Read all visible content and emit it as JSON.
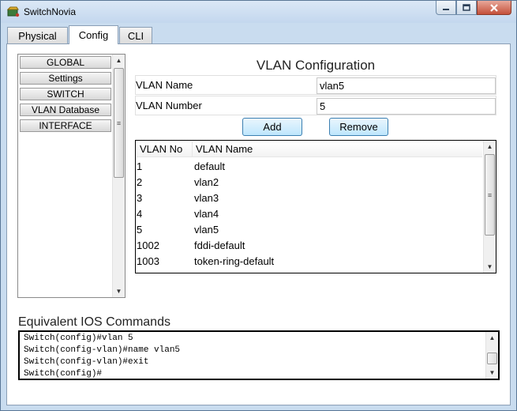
{
  "window": {
    "title": "SwitchNovia"
  },
  "tabs": [
    {
      "label": "Physical",
      "active": false
    },
    {
      "label": "Config",
      "active": true
    },
    {
      "label": "CLI",
      "active": false
    }
  ],
  "sidebar": {
    "items": [
      {
        "label": "GLOBAL"
      },
      {
        "label": "Settings"
      },
      {
        "label": "SWITCH"
      },
      {
        "label": "VLAN Database"
      },
      {
        "label": "INTERFACE"
      }
    ]
  },
  "vlan": {
    "heading": "VLAN Configuration",
    "name_label": "VLAN Name",
    "name_value": "vlan5",
    "number_label": "VLAN Number",
    "number_value": "5",
    "add_label": "Add",
    "remove_label": "Remove",
    "table": {
      "columns": [
        "VLAN No",
        "VLAN Name"
      ],
      "rows": [
        {
          "no": "1",
          "name": "default"
        },
        {
          "no": "2",
          "name": "vlan2"
        },
        {
          "no": "3",
          "name": "vlan3"
        },
        {
          "no": "4",
          "name": "vlan4"
        },
        {
          "no": "5",
          "name": "vlan5"
        },
        {
          "no": "1002",
          "name": "fddi-default"
        },
        {
          "no": "1003",
          "name": "token-ring-default"
        }
      ]
    }
  },
  "ios": {
    "title": "Equivalent IOS Commands",
    "lines": [
      "Switch(config)#vlan 5",
      "Switch(config-vlan)#name vlan5",
      "Switch(config-vlan)#exit",
      "Switch(config)#"
    ]
  },
  "colors": {
    "title_bar": "#c9dcef",
    "button_blue": "#bee6fd",
    "close_red": "#c4503a"
  }
}
